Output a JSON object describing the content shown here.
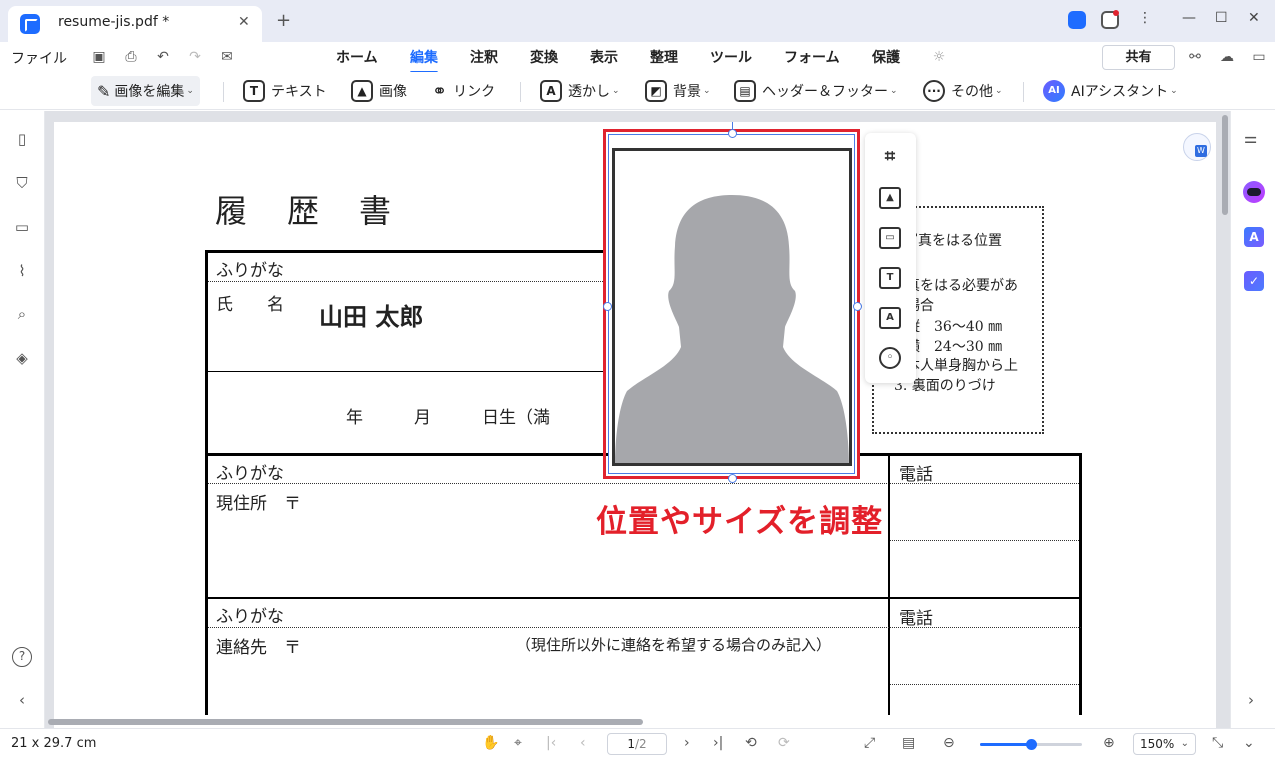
{
  "app": {
    "tab_title": "resume-jis.pdf *",
    "tab_close": "✕",
    "new_tab": "+"
  },
  "menu": {
    "file": "ファイル",
    "items": [
      "ホーム",
      "編集",
      "注釈",
      "変換",
      "表示",
      "整理",
      "ツール",
      "フォーム",
      "保護"
    ],
    "active": "編集",
    "share": "共有"
  },
  "toolbar": {
    "edit_image": "画像を編集",
    "text": "テキスト",
    "image": "画像",
    "link": "リンク",
    "watermark": "透かし",
    "background": "背景",
    "header_footer": "ヘッダー＆フッター",
    "more": "その他",
    "ai_badge": "AI",
    "ai_assistant": "AIアシスタント"
  },
  "document": {
    "title": "履　歴　書",
    "furigana_1": "ふりがな",
    "name_label": "氏　　名",
    "name_value": "山田  太郎",
    "birth_line": "年　　　月　　　日生（満",
    "furigana_2": "ふりがな",
    "address_label": "現住所　〒",
    "phone_1": "電話",
    "furigana_3": "ふりがな",
    "contact_label": "連絡先　〒",
    "contact_note": "（現住所以外に連絡を希望する場合のみ記入）",
    "phone_2": "電話",
    "photo_notes": [
      "写真をはる位置",
      "真をはる必要があ",
      "場合",
      "縦　36〜40 ㎜",
      "横　24〜30 ㎜",
      "本人単身胸から上",
      "3. 裏面のりづけ"
    ]
  },
  "annotation": "位置やサイズを調整",
  "status": {
    "page_size": "21 x 29.7 cm",
    "current_page": "1",
    "total_pages": "/2",
    "zoom": "150%",
    "zoom_level": 0.5
  },
  "colors": {
    "accent": "#1e6cff",
    "highlight": "#e0232f"
  }
}
